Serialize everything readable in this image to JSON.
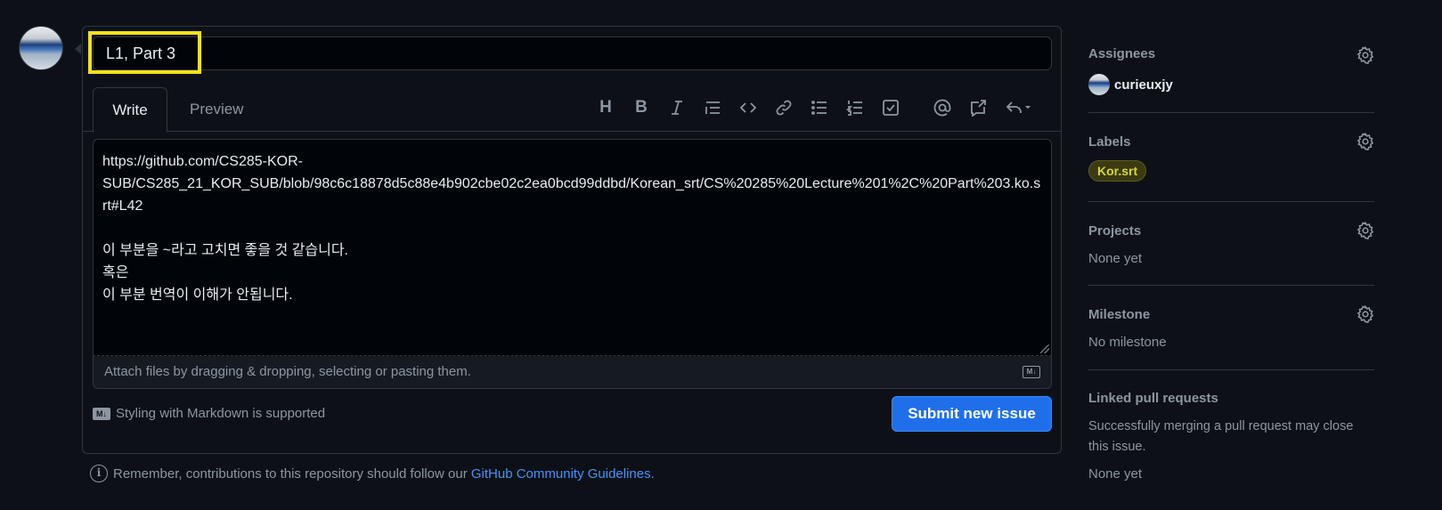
{
  "issue": {
    "title_value": "L1, Part 3",
    "tabs": {
      "write": "Write",
      "preview": "Preview"
    },
    "toolbar": {
      "items": [
        "heading-icon",
        "bold-icon",
        "italic-icon",
        "quote-icon",
        "code-icon",
        "link-icon",
        "unordered-list-icon",
        "ordered-list-icon",
        "task-list-icon",
        "mention-icon",
        "reference-icon",
        "reply-icon"
      ]
    },
    "body": "https://github.com/CS285-KOR-\nSUB/CS285_21_KOR_SUB/blob/98c6c18878d5c88e4b902cbe02c2ea0bcd99ddbd/Korean_srt/CS%20285%20Lecture%201%2C%20Part%203.ko.srt#L42\n\n이 부분을 ~라고 고치면 좋을 것 같습니다.\n혹은\n이 부분 번역이 이해가 안됩니다.",
    "attach_hint": "Attach files by dragging & dropping, selecting or pasting them.",
    "markdown_note": "Styling with Markdown is supported",
    "markdown_badge": "M↓",
    "submit_label": "Submit new issue",
    "guidelines_prefix": "Remember, contributions to this repository should follow our ",
    "guidelines_link": "GitHub Community Guidelines",
    "guidelines_suffix": "."
  },
  "sidebar": {
    "assignees": {
      "heading": "Assignees",
      "user": "curieuxjy"
    },
    "labels": {
      "heading": "Labels",
      "label": "Kor.srt",
      "label_color": "#d6d63a"
    },
    "projects": {
      "heading": "Projects",
      "value": "None yet"
    },
    "milestone": {
      "heading": "Milestone",
      "value": "No milestone"
    },
    "linked_prs": {
      "heading": "Linked pull requests",
      "description": "Successfully merging a pull request may close this issue.",
      "value": "None yet"
    }
  },
  "colors": {
    "background": "#0d1117",
    "accent": "#1f6feb",
    "link": "#4493f8",
    "highlight_box": "#f5e21a"
  }
}
